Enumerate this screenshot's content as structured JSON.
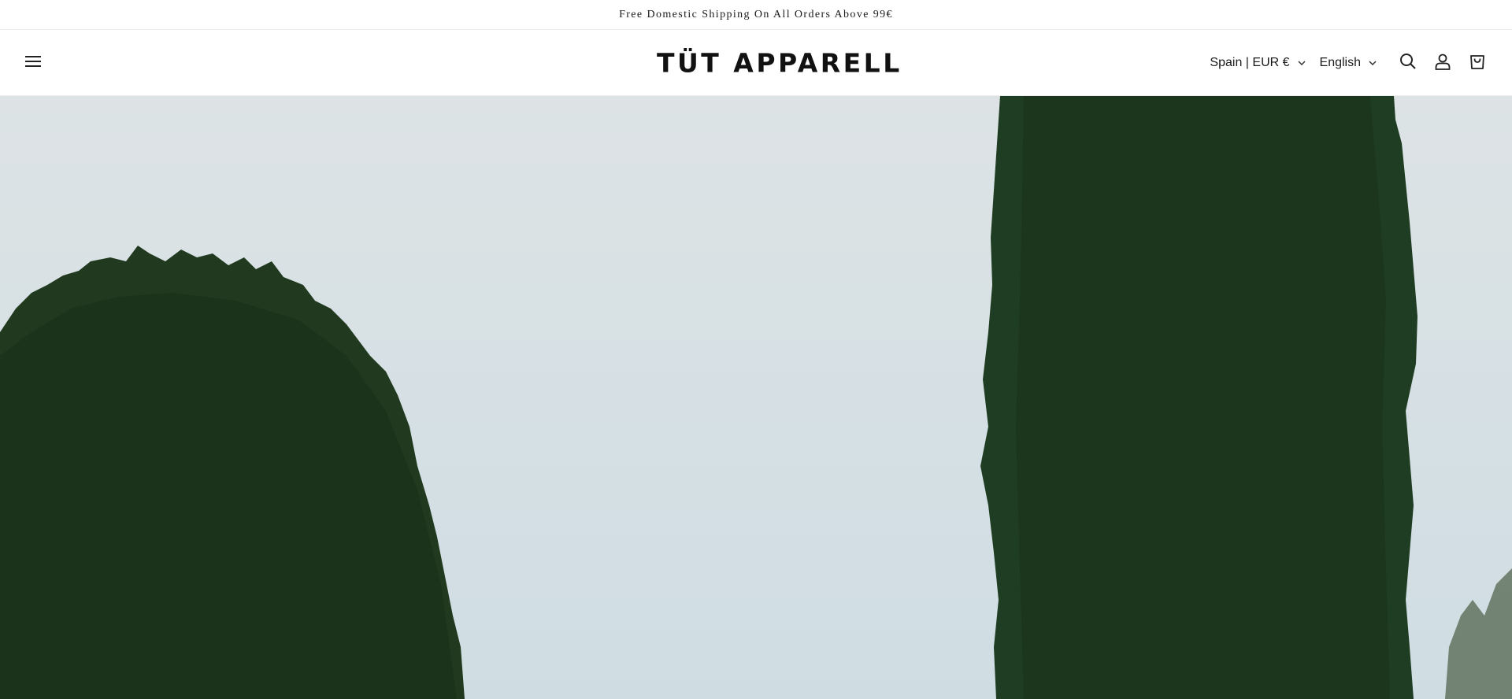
{
  "announcement": {
    "text": "Free Domestic Shipping On All Orders Above 99€"
  },
  "header": {
    "logo_text": "TÜT APPARELL",
    "country_selector": "Spain | EUR €",
    "language_selector": "English",
    "icons": {
      "menu": "hamburger-menu-icon",
      "search": "search-icon",
      "account": "account-icon",
      "cart": "cart-icon"
    }
  },
  "hero": {
    "image": "cypress-trees-against-pale-sky",
    "colors": {
      "sky": "#cfdde3",
      "foliage": "#1f3d22"
    }
  }
}
